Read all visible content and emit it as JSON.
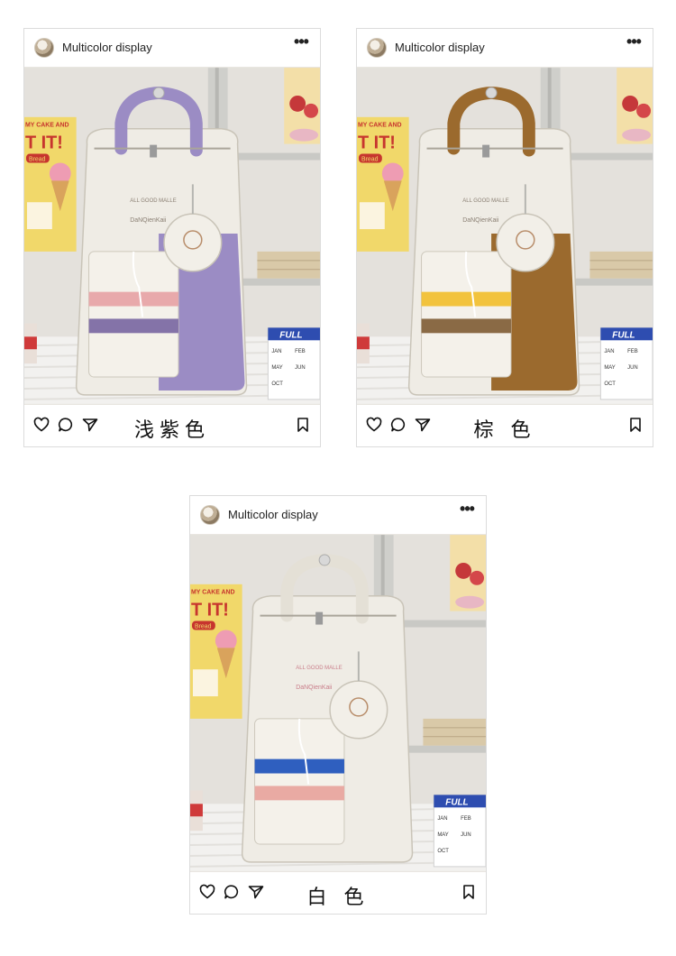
{
  "posts": [
    {
      "username": "Multicolor display",
      "more": "•••",
      "caption": "浅紫色",
      "accent": "#9b8cc4",
      "accent_dark": "#7a6aa8",
      "stripe1": "#e8a9ab",
      "stripe2": "#8473a8"
    },
    {
      "username": "Multicolor display",
      "more": "•••",
      "caption": "棕 色",
      "accent": "#9b6a2e",
      "accent_dark": "#7b501f",
      "stripe1": "#f2c33d",
      "stripe2": "#8a6a45"
    },
    {
      "username": "Multicolor display",
      "more": "•••",
      "caption": "白 色",
      "accent": "#ece8e0",
      "accent_dark": "#cfcac0",
      "stripe1": "#2f5fbf",
      "stripe2": "#e9aaa3"
    }
  ],
  "photo_text": {
    "poster_top": "MY CAKE AND",
    "poster_big": "T IT!",
    "poster_tag": "Bread",
    "bag_brand": "ALL GOOD MALLE",
    "bag_brand2": "DaNQienKaii",
    "calendar_brand": "FULL",
    "calendar_months": [
      "JAN",
      "FEB",
      "MAY",
      "JUN",
      "OCT"
    ]
  },
  "icons": [
    "heart-icon",
    "comment-icon",
    "send-icon",
    "bookmark-icon",
    "more-icon"
  ]
}
